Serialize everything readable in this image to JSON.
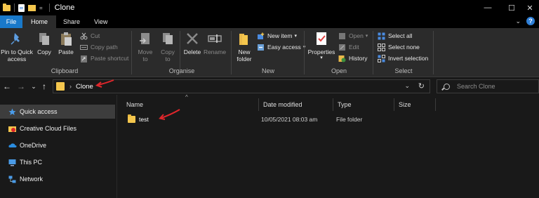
{
  "window": {
    "title": "Clone",
    "qa_dropdown": "=",
    "controls": {
      "minimize": "—",
      "maximize": "☐",
      "close": "✕"
    }
  },
  "tabs": [
    {
      "label": "File"
    },
    {
      "label": "Home"
    },
    {
      "label": "Share"
    },
    {
      "label": "View"
    }
  ],
  "tabs_right": {
    "collapse": "⌄",
    "help": "?"
  },
  "ribbon": {
    "clipboard": {
      "label": "Clipboard",
      "pin": "Pin to Quick access",
      "copy": "Copy",
      "paste": "Paste",
      "cut": "Cut",
      "copy_path": "Copy path",
      "paste_shortcut": "Paste shortcut"
    },
    "organise": {
      "label": "Organise",
      "move_to": "Move to",
      "copy_to": "Copy to",
      "delete": "Delete",
      "rename": "Rename"
    },
    "new": {
      "label": "New",
      "new_folder": "New folder",
      "new_item": "New item",
      "easy_access": "Easy access"
    },
    "open": {
      "label": "Open",
      "properties": "Properties",
      "open": "Open",
      "edit": "Edit",
      "history": "History"
    },
    "select": {
      "label": "Select",
      "select_all": "Select all",
      "select_none": "Select none",
      "invert_selection": "Invert selection"
    }
  },
  "nav": {
    "back": "←",
    "forward": "→",
    "recent": "⌄",
    "up": "↑",
    "breadcrumb_sep": "›",
    "path": "Clone",
    "dropdown": "⌄",
    "refresh": "↻"
  },
  "search": {
    "placeholder": "Search Clone"
  },
  "sidebar": {
    "items": [
      {
        "label": "Quick access"
      },
      {
        "label": "Creative Cloud Files"
      },
      {
        "label": "OneDrive"
      },
      {
        "label": "This PC"
      },
      {
        "label": "Network"
      }
    ]
  },
  "columns": {
    "name": "Name",
    "date": "Date modified",
    "type": "Type",
    "size": "Size",
    "sort": "^"
  },
  "files": [
    {
      "name": "test",
      "date": "10/05/2021 08:03 am",
      "type": "File folder",
      "size": ""
    }
  ],
  "colors": {
    "accent": "#1979ca",
    "folder": "#f4c64d",
    "annotation": "#e0262b",
    "background": "#191919",
    "ribbon": "#2b2b2b"
  }
}
